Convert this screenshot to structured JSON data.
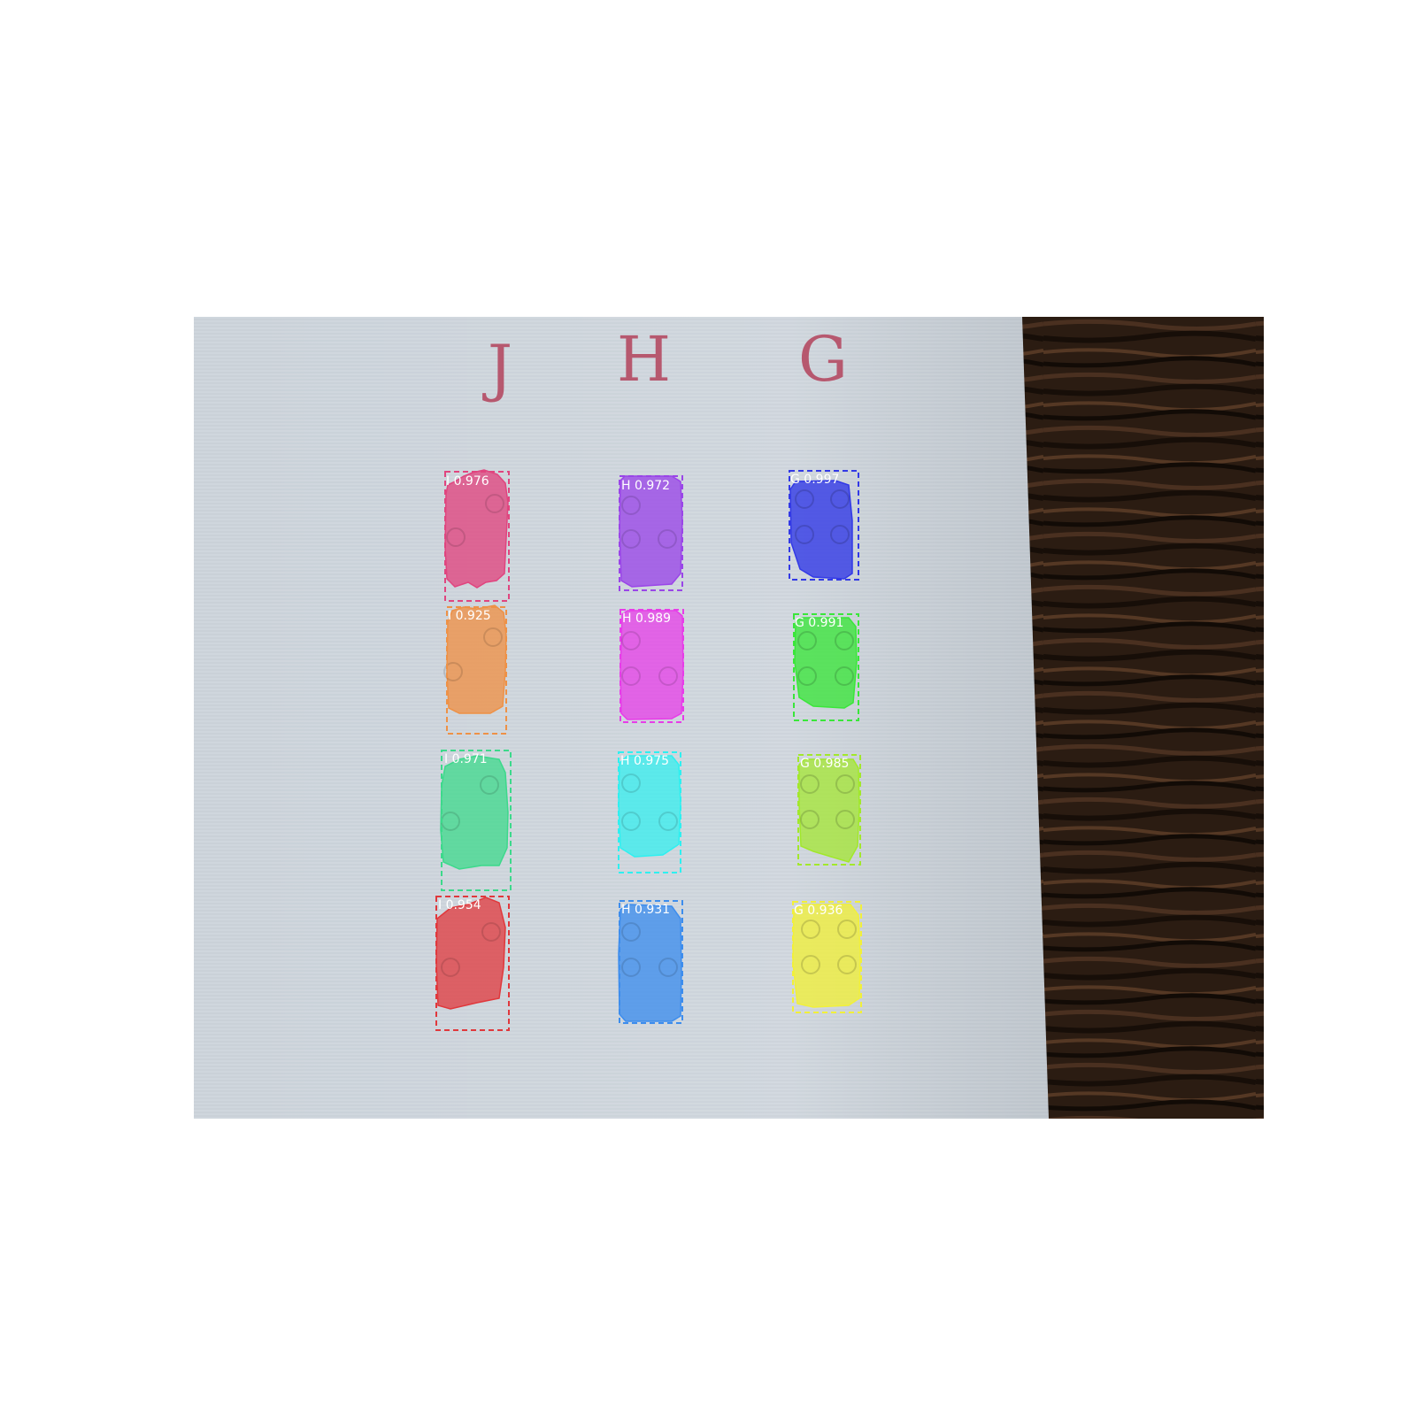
{
  "image": {
    "description": "Photo of braille cells on white paper with instance segmentation overlays",
    "handwritten_letters": [
      "J",
      "H",
      "G"
    ]
  },
  "detections": [
    {
      "label": "I 0.976",
      "color": "#e0457f"
    },
    {
      "label": "I 0.925",
      "color": "#ee9146"
    },
    {
      "label": "I 0.971",
      "color": "#3cd98b"
    },
    {
      "label": "I 0.954",
      "color": "#e0383c"
    },
    {
      "label": "H 0.972",
      "color": "#9a45e8"
    },
    {
      "label": "H 0.989",
      "color": "#e73ce8"
    },
    {
      "label": "H 0.975",
      "color": "#2ef0f0"
    },
    {
      "label": "H 0.931",
      "color": "#3d8ded"
    },
    {
      "label": "G 0.997",
      "color": "#3239e6"
    },
    {
      "label": "G 0.991",
      "color": "#3ae63a"
    },
    {
      "label": "G 0.985",
      "color": "#a2e82b"
    },
    {
      "label": "G 0.936",
      "color": "#f1f03a"
    }
  ]
}
